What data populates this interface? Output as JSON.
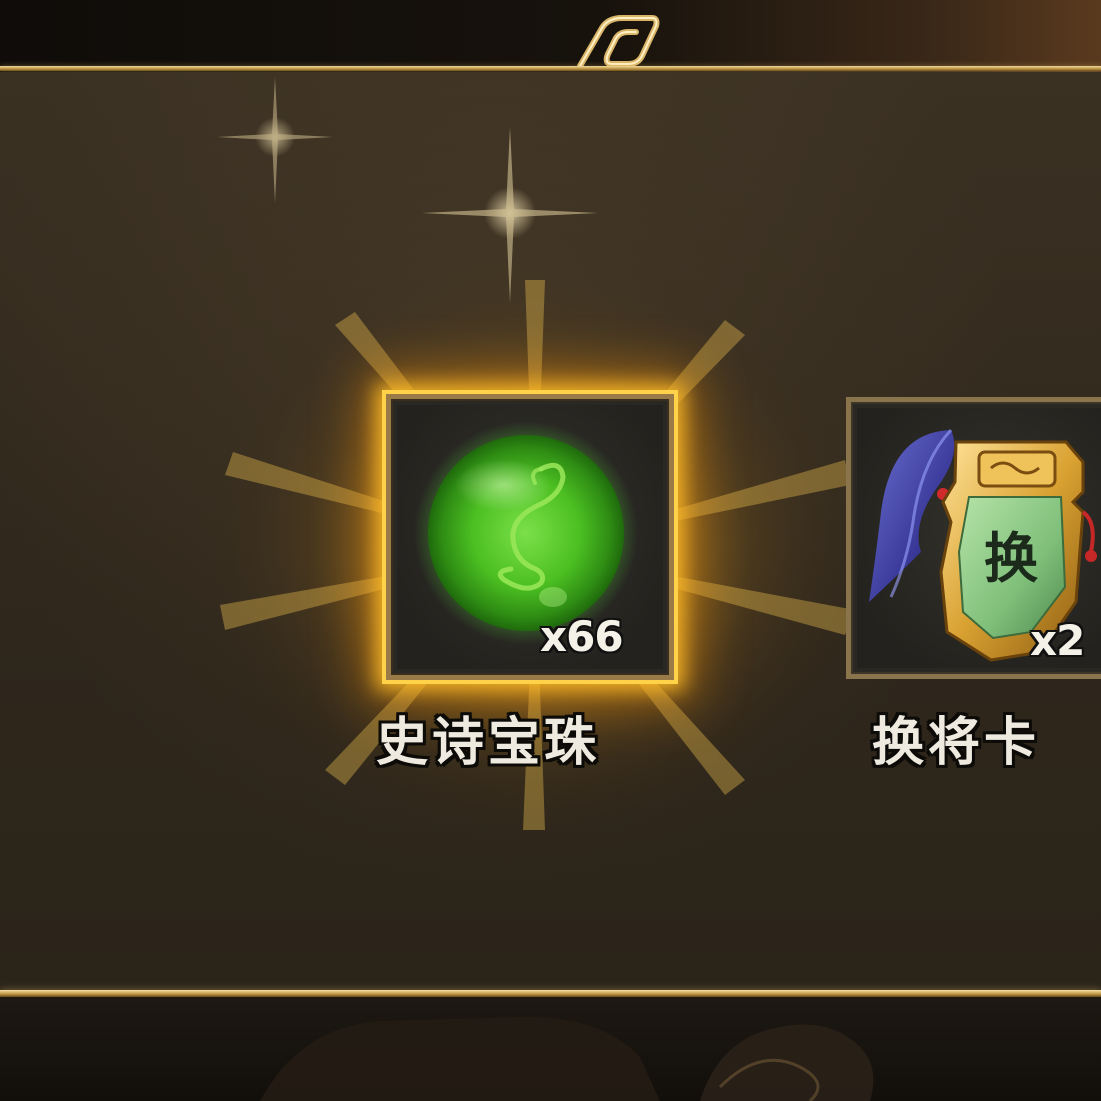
{
  "rewards": {
    "items": [
      {
        "name": "史诗宝珠",
        "count": "x66",
        "icon": "green-orb-icon",
        "highlighted": true,
        "highlight_color": "#ffc830"
      },
      {
        "name": "换将卡",
        "count": "x2",
        "icon": "swap-general-card-icon",
        "highlighted": false
      }
    ]
  },
  "theme": {
    "panel_bg": "#2f271c",
    "border_gold": "#c39a48",
    "text_color": "#eeeae0"
  }
}
